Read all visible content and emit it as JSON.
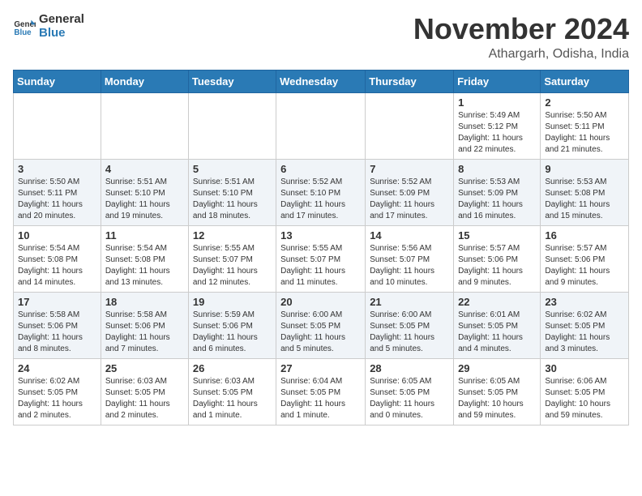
{
  "logo": {
    "general": "General",
    "blue": "Blue"
  },
  "header": {
    "month": "November 2024",
    "location": "Athargarh, Odisha, India"
  },
  "weekdays": [
    "Sunday",
    "Monday",
    "Tuesday",
    "Wednesday",
    "Thursday",
    "Friday",
    "Saturday"
  ],
  "weeks": [
    [
      {
        "day": "",
        "info": ""
      },
      {
        "day": "",
        "info": ""
      },
      {
        "day": "",
        "info": ""
      },
      {
        "day": "",
        "info": ""
      },
      {
        "day": "",
        "info": ""
      },
      {
        "day": "1",
        "info": "Sunrise: 5:49 AM\nSunset: 5:12 PM\nDaylight: 11 hours\nand 22 minutes."
      },
      {
        "day": "2",
        "info": "Sunrise: 5:50 AM\nSunset: 5:11 PM\nDaylight: 11 hours\nand 21 minutes."
      }
    ],
    [
      {
        "day": "3",
        "info": "Sunrise: 5:50 AM\nSunset: 5:11 PM\nDaylight: 11 hours\nand 20 minutes."
      },
      {
        "day": "4",
        "info": "Sunrise: 5:51 AM\nSunset: 5:10 PM\nDaylight: 11 hours\nand 19 minutes."
      },
      {
        "day": "5",
        "info": "Sunrise: 5:51 AM\nSunset: 5:10 PM\nDaylight: 11 hours\nand 18 minutes."
      },
      {
        "day": "6",
        "info": "Sunrise: 5:52 AM\nSunset: 5:10 PM\nDaylight: 11 hours\nand 17 minutes."
      },
      {
        "day": "7",
        "info": "Sunrise: 5:52 AM\nSunset: 5:09 PM\nDaylight: 11 hours\nand 17 minutes."
      },
      {
        "day": "8",
        "info": "Sunrise: 5:53 AM\nSunset: 5:09 PM\nDaylight: 11 hours\nand 16 minutes."
      },
      {
        "day": "9",
        "info": "Sunrise: 5:53 AM\nSunset: 5:08 PM\nDaylight: 11 hours\nand 15 minutes."
      }
    ],
    [
      {
        "day": "10",
        "info": "Sunrise: 5:54 AM\nSunset: 5:08 PM\nDaylight: 11 hours\nand 14 minutes."
      },
      {
        "day": "11",
        "info": "Sunrise: 5:54 AM\nSunset: 5:08 PM\nDaylight: 11 hours\nand 13 minutes."
      },
      {
        "day": "12",
        "info": "Sunrise: 5:55 AM\nSunset: 5:07 PM\nDaylight: 11 hours\nand 12 minutes."
      },
      {
        "day": "13",
        "info": "Sunrise: 5:55 AM\nSunset: 5:07 PM\nDaylight: 11 hours\nand 11 minutes."
      },
      {
        "day": "14",
        "info": "Sunrise: 5:56 AM\nSunset: 5:07 PM\nDaylight: 11 hours\nand 10 minutes."
      },
      {
        "day": "15",
        "info": "Sunrise: 5:57 AM\nSunset: 5:06 PM\nDaylight: 11 hours\nand 9 minutes."
      },
      {
        "day": "16",
        "info": "Sunrise: 5:57 AM\nSunset: 5:06 PM\nDaylight: 11 hours\nand 9 minutes."
      }
    ],
    [
      {
        "day": "17",
        "info": "Sunrise: 5:58 AM\nSunset: 5:06 PM\nDaylight: 11 hours\nand 8 minutes."
      },
      {
        "day": "18",
        "info": "Sunrise: 5:58 AM\nSunset: 5:06 PM\nDaylight: 11 hours\nand 7 minutes."
      },
      {
        "day": "19",
        "info": "Sunrise: 5:59 AM\nSunset: 5:06 PM\nDaylight: 11 hours\nand 6 minutes."
      },
      {
        "day": "20",
        "info": "Sunrise: 6:00 AM\nSunset: 5:05 PM\nDaylight: 11 hours\nand 5 minutes."
      },
      {
        "day": "21",
        "info": "Sunrise: 6:00 AM\nSunset: 5:05 PM\nDaylight: 11 hours\nand 5 minutes."
      },
      {
        "day": "22",
        "info": "Sunrise: 6:01 AM\nSunset: 5:05 PM\nDaylight: 11 hours\nand 4 minutes."
      },
      {
        "day": "23",
        "info": "Sunrise: 6:02 AM\nSunset: 5:05 PM\nDaylight: 11 hours\nand 3 minutes."
      }
    ],
    [
      {
        "day": "24",
        "info": "Sunrise: 6:02 AM\nSunset: 5:05 PM\nDaylight: 11 hours\nand 2 minutes."
      },
      {
        "day": "25",
        "info": "Sunrise: 6:03 AM\nSunset: 5:05 PM\nDaylight: 11 hours\nand 2 minutes."
      },
      {
        "day": "26",
        "info": "Sunrise: 6:03 AM\nSunset: 5:05 PM\nDaylight: 11 hours\nand 1 minute."
      },
      {
        "day": "27",
        "info": "Sunrise: 6:04 AM\nSunset: 5:05 PM\nDaylight: 11 hours\nand 1 minute."
      },
      {
        "day": "28",
        "info": "Sunrise: 6:05 AM\nSunset: 5:05 PM\nDaylight: 11 hours\nand 0 minutes."
      },
      {
        "day": "29",
        "info": "Sunrise: 6:05 AM\nSunset: 5:05 PM\nDaylight: 10 hours\nand 59 minutes."
      },
      {
        "day": "30",
        "info": "Sunrise: 6:06 AM\nSunset: 5:05 PM\nDaylight: 10 hours\nand 59 minutes."
      }
    ]
  ]
}
